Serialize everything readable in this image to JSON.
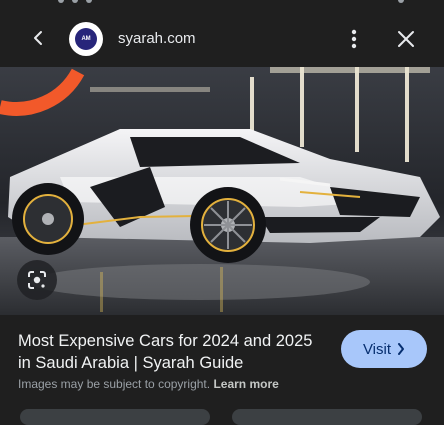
{
  "header": {
    "site_name": "syarah.com",
    "logo_text": "ᴬᴷ"
  },
  "result": {
    "title": "Most Expensive Cars for 2024 and 2025 in Saudi Arabia | Syarah Guide",
    "copyright_text": "Images may be subject to copyright.",
    "learn_more": "Learn more",
    "visit_label": "Visit"
  },
  "icons": {
    "back": "chevron-left-icon",
    "more": "more-vert-icon",
    "close": "close-icon",
    "lens": "google-lens-icon",
    "visit_arrow": "chevron-right-icon"
  },
  "colors": {
    "background": "#1f1f1f",
    "visit_button": "#a8c7fa",
    "visit_text": "#062e6f"
  }
}
